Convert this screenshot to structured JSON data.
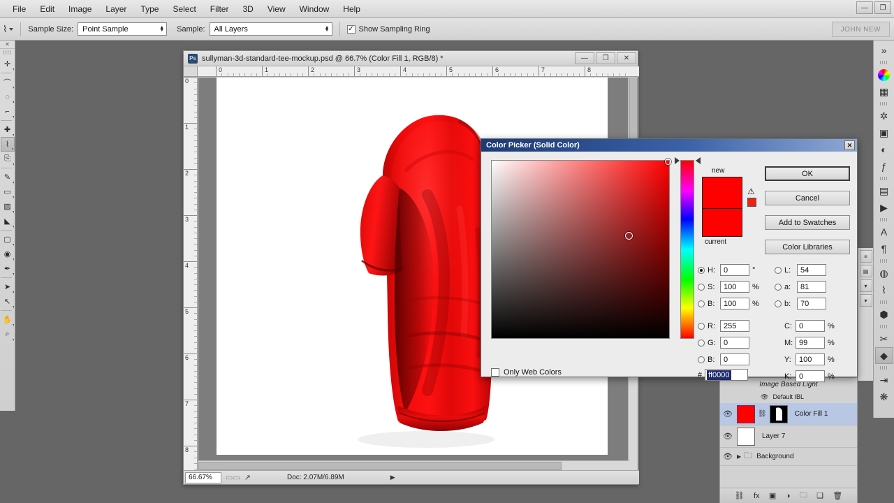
{
  "app": {
    "menu": [
      "File",
      "Edit",
      "Image",
      "Layer",
      "Type",
      "Select",
      "Filter",
      "3D",
      "View",
      "Window",
      "Help"
    ],
    "window_buttons": {
      "minimize": "—",
      "restore": "❐"
    },
    "workspace_label": "JOHN NEW"
  },
  "options_bar": {
    "tool_icon": "eyedropper-icon",
    "sample_size_label": "Sample Size:",
    "sample_size_value": "Point Sample",
    "sample_label": "Sample:",
    "sample_value": "All Layers",
    "show_sampling_ring_label": "Show Sampling Ring",
    "show_sampling_ring_checked": "✓"
  },
  "toolbar": {
    "tools": [
      {
        "name": "move-tool",
        "glyph": "✛"
      },
      {
        "name": "lasso-tool",
        "glyph": "⌒"
      },
      {
        "name": "quick-select-tool",
        "glyph": "◌"
      },
      {
        "name": "crop-tool",
        "glyph": "⌐"
      },
      {
        "name": "healing-brush-tool",
        "glyph": "✚"
      },
      {
        "name": "eyedropper-tool",
        "glyph": "⌇",
        "selected": true
      },
      {
        "name": "clone-stamp-tool",
        "glyph": "⎘"
      },
      {
        "name": "brush-tool",
        "glyph": "✎"
      },
      {
        "name": "eraser-tool",
        "glyph": "▭"
      },
      {
        "name": "gradient-tool",
        "glyph": "▨"
      },
      {
        "name": "blur-tool",
        "glyph": "◣"
      },
      {
        "name": "rectangle-tool",
        "glyph": "▢"
      },
      {
        "name": "dodge-tool",
        "glyph": "◉"
      },
      {
        "name": "pen-tool",
        "glyph": "✒"
      },
      {
        "name": "type-tool",
        "glyph": "➤"
      },
      {
        "name": "path-select-tool",
        "glyph": "↖"
      },
      {
        "name": "hand-tool",
        "glyph": "✋"
      },
      {
        "name": "zoom-tool",
        "glyph": "⌕"
      }
    ]
  },
  "document": {
    "title": "sullyman-3d-standard-tee-mockup.psd @ 66.7% (Color Fill 1, RGB/8) *",
    "app_badge": "Ps",
    "win_minimize": "—",
    "win_maximize": "❐",
    "win_close": "✕",
    "ruler_h_labels": [
      "0",
      "1",
      "2",
      "3",
      "4",
      "5",
      "6",
      "7",
      "8"
    ],
    "ruler_v_labels": [
      "0",
      "1",
      "2",
      "3",
      "4",
      "5",
      "6",
      "7",
      "8"
    ],
    "zoom": "66.67%",
    "doc_info": "Doc: 2.07M/6.89M",
    "status_arrow": "▶",
    "canvas_bg": "#ffffff",
    "artwork": "red-tshirt-3d-side-view"
  },
  "color_picker": {
    "title": "Color Picker (Solid Color)",
    "close_glyph": "✕",
    "new_label": "new",
    "current_label": "current",
    "new_color": "#ff0000",
    "current_color": "#ff0000",
    "gamut_warning_glyph": "⚠",
    "gamut_warning_color": "#e03020",
    "buttons": {
      "ok": "OK",
      "cancel": "Cancel",
      "add_to_swatches": "Add to Swatches",
      "color_libraries": "Color Libraries"
    },
    "only_web_colors_label": "Only Web Colors",
    "only_web_colors_checked": false,
    "hsb": [
      {
        "key": "H",
        "value": "0",
        "unit": "°",
        "selected": true
      },
      {
        "key": "S",
        "value": "100",
        "unit": "%",
        "selected": false
      },
      {
        "key": "B",
        "value": "100",
        "unit": "%",
        "selected": false
      }
    ],
    "rgb": [
      {
        "key": "R",
        "value": "255",
        "unit": "",
        "selected": false
      },
      {
        "key": "G",
        "value": "0",
        "unit": "",
        "selected": false
      },
      {
        "key": "B",
        "value": "0",
        "unit": "",
        "selected": false
      }
    ],
    "lab": [
      {
        "key": "L",
        "value": "54",
        "unit": "",
        "selected": false
      },
      {
        "key": "a",
        "value": "81",
        "unit": "",
        "selected": false
      },
      {
        "key": "b",
        "value": "70",
        "unit": "",
        "selected": false
      }
    ],
    "cmyk": [
      {
        "key": "C",
        "value": "0",
        "unit": "%"
      },
      {
        "key": "M",
        "value": "99",
        "unit": "%"
      },
      {
        "key": "Y",
        "value": "100",
        "unit": "%"
      },
      {
        "key": "K",
        "value": "0",
        "unit": "%"
      }
    ],
    "hex_label": "#",
    "hex_value": "ff0000"
  },
  "right_rail": {
    "icons": [
      {
        "name": "collapse-panels-icon",
        "glyph": "»"
      },
      {
        "name": "color-wheel-icon",
        "glyph": "◉"
      },
      {
        "name": "swatches-icon",
        "glyph": "▦"
      },
      {
        "name": "adjustments-icon",
        "glyph": "✲"
      },
      {
        "name": "masks-icon",
        "glyph": "▣"
      },
      {
        "name": "histogram-icon",
        "glyph": "◐"
      },
      {
        "name": "styles-icon",
        "glyph": "ƒ"
      },
      {
        "name": "layer-comps-icon",
        "glyph": "▤"
      },
      {
        "name": "timeline-icon",
        "glyph": "▶"
      },
      {
        "name": "character-icon",
        "glyph": "A"
      },
      {
        "name": "paragraph-icon",
        "glyph": "¶"
      },
      {
        "name": "3d-materials-icon",
        "glyph": "◍"
      },
      {
        "name": "paths-icon",
        "glyph": "⌇"
      },
      {
        "name": "3d-panel-icon",
        "glyph": "⬢"
      },
      {
        "name": "tools-icon",
        "glyph": "✂"
      },
      {
        "name": "layers-icon",
        "glyph": "◆",
        "selected": true
      },
      {
        "name": "channels-icon",
        "glyph": "⇥"
      },
      {
        "name": "brushes-icon",
        "glyph": "❋"
      }
    ]
  },
  "layers_panel": {
    "group_label": "Image Based Light",
    "sublayer": {
      "eye": "👁",
      "label": "Default IBL"
    },
    "rows": [
      {
        "name": "Color Fill 1",
        "eye": "👁",
        "selected": true,
        "thumb_color": "#ff0000",
        "has_mask": true,
        "link": "⛓"
      },
      {
        "name": "Layer 7",
        "eye": "👁",
        "selected": false,
        "thumb_color": "#ffffff",
        "has_mask": false
      },
      {
        "name": "Background",
        "eye": "👁",
        "selected": false,
        "is_group": true,
        "expand": "▶",
        "folder": "🗀"
      }
    ],
    "footer_icons": [
      {
        "name": "link-layers-icon",
        "glyph": "⛓"
      },
      {
        "name": "layer-style-icon",
        "glyph": "fx"
      },
      {
        "name": "layer-mask-icon",
        "glyph": "▣"
      },
      {
        "name": "adjustment-layer-icon",
        "glyph": "◑"
      },
      {
        "name": "new-group-icon",
        "glyph": "🗀"
      },
      {
        "name": "new-layer-icon",
        "glyph": "❑"
      },
      {
        "name": "delete-layer-icon",
        "glyph": "🗑"
      }
    ]
  }
}
